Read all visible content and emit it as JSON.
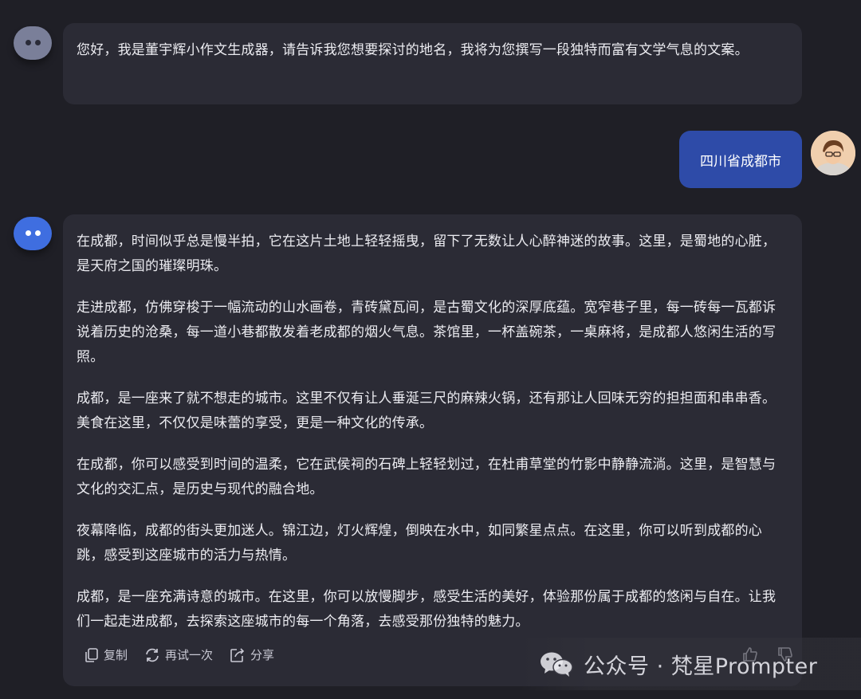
{
  "chat": {
    "greeting": "您好，我是董宇辉小作文生成器，请告诉我您想要探讨的地名，我将为您撰写一段独特而富有文学气息的文案。",
    "user_message": "四川省成都市",
    "answer": [
      "在成都，时间似乎总是慢半拍，它在这片土地上轻轻摇曳，留下了无数让人心醉神迷的故事。这里，是蜀地的心脏，是天府之国的璀璨明珠。",
      "走进成都，仿佛穿梭于一幅流动的山水画卷，青砖黛瓦间，是古蜀文化的深厚底蕴。宽窄巷子里，每一砖每一瓦都诉说着历史的沧桑，每一道小巷都散发着老成都的烟火气息。茶馆里，一杯盖碗茶，一桌麻将，是成都人悠闲生活的写照。",
      "成都，是一座来了就不想走的城市。这里不仅有让人垂涎三尺的麻辣火锅，还有那让人回味无穷的担担面和串串香。美食在这里，不仅仅是味蕾的享受，更是一种文化的传承。",
      "在成都，你可以感受到时间的温柔，它在武侯祠的石碑上轻轻划过，在杜甫草堂的竹影中静静流淌。这里，是智慧与文化的交汇点，是历史与现代的融合地。",
      "夜幕降临，成都的街头更加迷人。锦江边，灯火辉煌，倒映在水中，如同繁星点点。在这里，你可以听到成都的心跳，感受到这座城市的活力与热情。",
      "成都，是一座充满诗意的城市。在这里，你可以放慢脚步，感受生活的美好，体验那份属于成都的悠闲与自在。让我们一起走进成都，去探索这座城市的每一个角落，去感受那份独特的魅力。"
    ]
  },
  "actions": {
    "copy": "复制",
    "retry": "再试一次",
    "share": "分享"
  },
  "watermark": {
    "text": "公众号 · 梵星Prompter"
  },
  "icons": [
    "bot-avatar-icon",
    "copy-icon",
    "retry-icon",
    "share-icon",
    "thumb-up-icon",
    "thumb-down-icon",
    "wechat-icon"
  ],
  "colors": {
    "background": "#1f1f26",
    "bubble": "#2b2b35",
    "user_bubble": "#2e4ba8",
    "bot_avatar_blue": "#3f6ee0",
    "bot_avatar_grey": "#7a7f99"
  }
}
